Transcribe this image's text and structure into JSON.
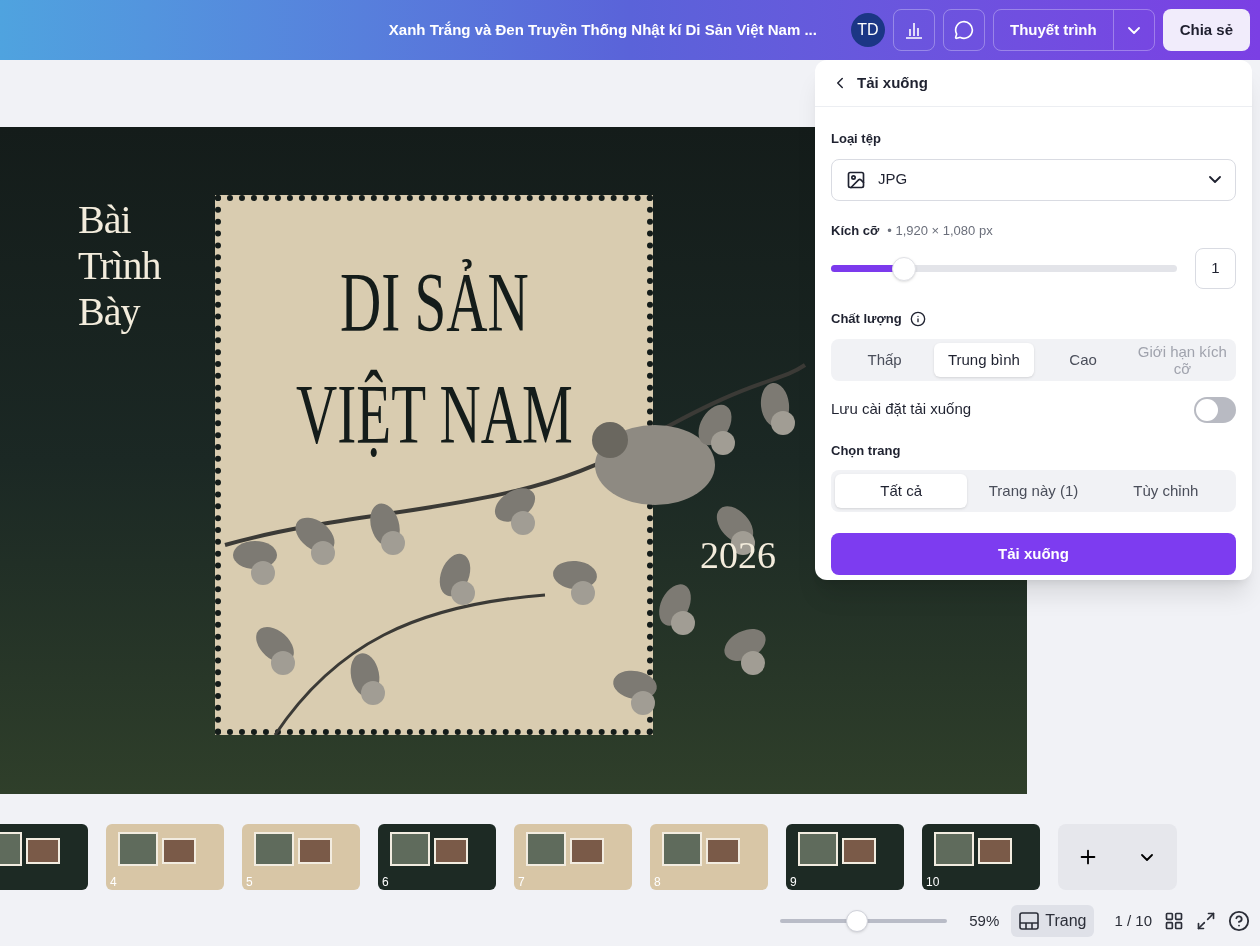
{
  "topbar": {
    "title": "Xanh Trắng và Đen Truyền Thống Nhật kí Di Sản Việt Nam ...",
    "avatar": "TD",
    "present_button": "Thuyết trình",
    "share_button": "Chia sẻ"
  },
  "slide": {
    "subtitle": "Bài Trình Bày",
    "title_lines": [
      "DI SẢN",
      "VIỆT NAM"
    ],
    "year": "2026"
  },
  "download_panel": {
    "title": "Tải xuống",
    "file_type": {
      "label": "Loại tệp",
      "value": "JPG"
    },
    "size": {
      "label": "Kích cỡ",
      "dimensions": "• 1,920 × 1,080 px",
      "level": 0.21,
      "value": "1"
    },
    "quality": {
      "label": "Chất lượng",
      "options": [
        {
          "label": "Thấp",
          "selected": false,
          "disabled": false
        },
        {
          "label": "Trung bình",
          "selected": true,
          "disabled": false
        },
        {
          "label": "Cao",
          "selected": false,
          "disabled": false
        },
        {
          "label": "Giới hạn kích cỡ",
          "selected": false,
          "disabled": true
        }
      ]
    },
    "save_settings": {
      "label": "Lưu cài đặt tải xuống",
      "on": false
    },
    "pages": {
      "label": "Chọn trang",
      "options": [
        {
          "label": "Tất cả",
          "selected": true
        },
        {
          "label": "Trang này (1)",
          "selected": false
        },
        {
          "label": "Tùy chỉnh",
          "selected": false
        }
      ]
    },
    "button": "Tải xuống"
  },
  "thumbnails": [
    {
      "kind": "dark"
    },
    {
      "kind": "beige",
      "number": "4"
    },
    {
      "kind": "beige",
      "number": "5"
    },
    {
      "kind": "dark",
      "number": "6"
    },
    {
      "kind": "beige",
      "number": "7"
    },
    {
      "kind": "beige",
      "number": "8"
    },
    {
      "kind": "dark",
      "number": "9"
    },
    {
      "kind": "dark",
      "number": "10"
    }
  ],
  "bottom_bar": {
    "zoom": {
      "level": 0.46,
      "reading": "59%"
    },
    "pages_button": "Trang",
    "page_count": "1 / 10"
  }
}
